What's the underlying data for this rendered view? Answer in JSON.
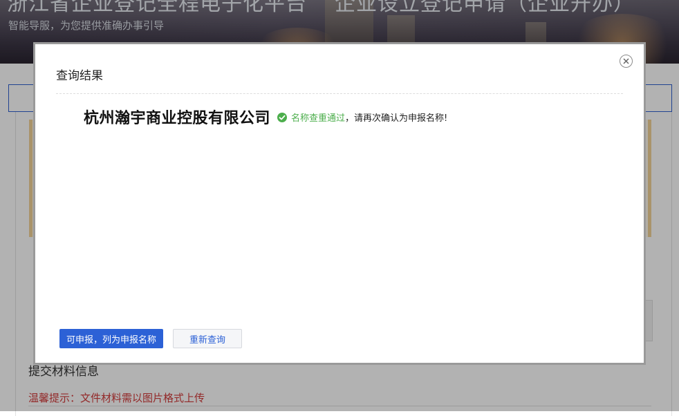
{
  "header": {
    "title": "浙江省企业登记全程电子化平台",
    "subtitle_page": "企业设立登记申请（企业开办）",
    "tagline": "智能导服，为您提供准确办事引导"
  },
  "page": {
    "section_title": "提交材料信息",
    "tip": "温馨提示：文件材料需以图片格式上传"
  },
  "modal": {
    "title": "查询结果",
    "company_name": "杭州瀚宇商业控股有限公司",
    "check_status": "名称查重通过",
    "check_note": "，请再次确认为申报名称!",
    "primary_button": "可申报，列为申报名称",
    "secondary_button": "重新查询",
    "close_icon": "close-circle-icon",
    "status_icon": "check-circle-icon"
  },
  "colors": {
    "accent_blue": "#2c61d6",
    "success_green": "#4cae4c",
    "tip_red": "#d33b3b"
  }
}
